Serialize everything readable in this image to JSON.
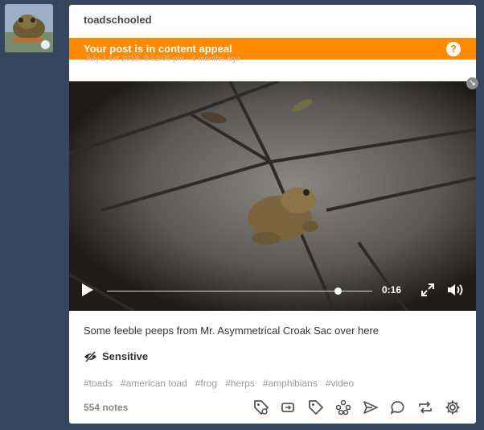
{
  "blog": {
    "name": "toadschooled"
  },
  "post": {
    "banner_text": "Your post is in content appeal",
    "date_text": "July 2 1st 2018, 8:12:05 pm · 4 months ago",
    "video": {
      "time": "0:16",
      "progress": 0.87
    },
    "caption": "Some feeble peeps from Mr. Asymmetrical Croak Sac over here",
    "sensitive_label": "Sensitive",
    "tags": [
      "#toads",
      "#american toad",
      "#frog",
      "#herps",
      "#amphibians",
      "#video"
    ],
    "notes": "554 notes"
  },
  "icons": {
    "help": "?",
    "expand_corner": "↘"
  },
  "colors": {
    "banner": "#ff8a00",
    "background": "#36465d"
  }
}
